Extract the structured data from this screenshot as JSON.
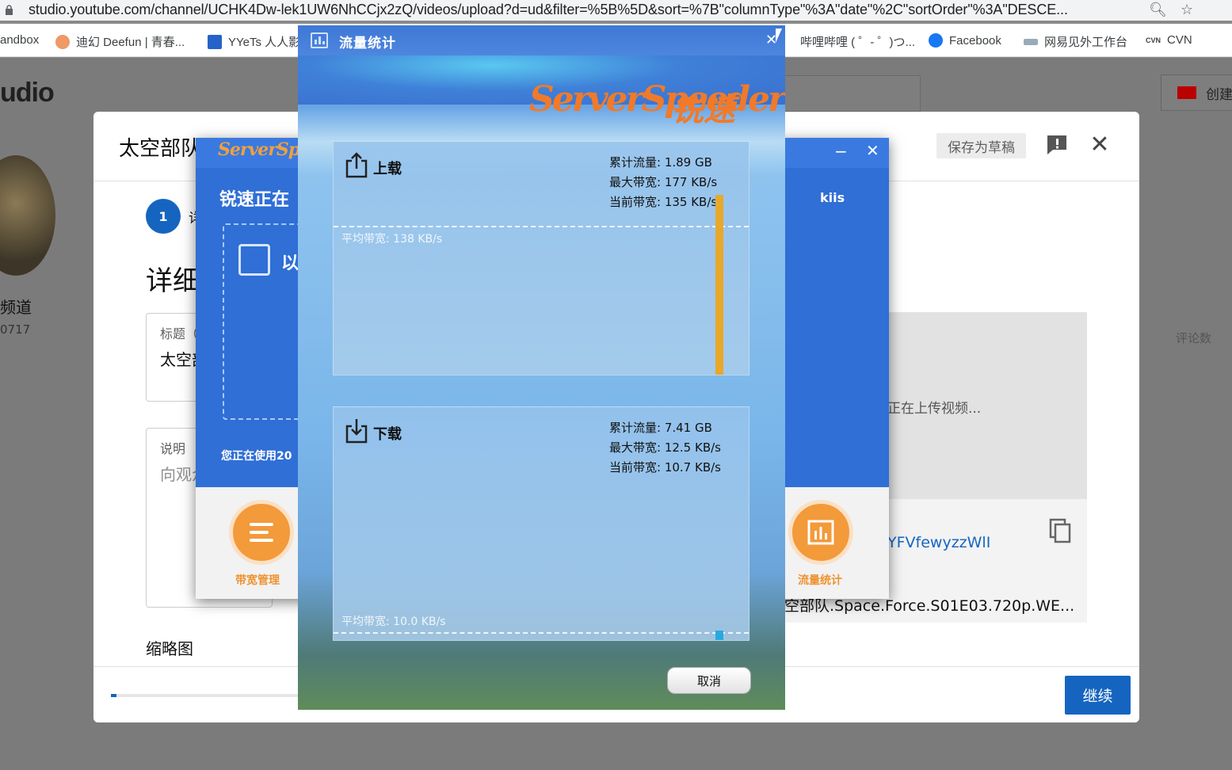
{
  "browser": {
    "url": "studio.youtube.com/channel/UCHK4Dw-lek1UW6NhCCjx2zQ/videos/upload?d=ud&filter=%5B%5D&sort=%7B\"columnType\"%3A\"date\"%2C\"sortOrder\"%3A\"DESCE...",
    "bookmarks": [
      "andbox",
      "迪幻 Deefun | 青春...",
      "YYeTs 人人影",
      "哔哩哔哩 ( ゜- ゜)つ...",
      "Facebook",
      "网易见外工作台",
      "CVN"
    ]
  },
  "studio": {
    "logo": "udio",
    "create_label": "创建",
    "channel_name": "频道",
    "channel_sub": "0717",
    "comments_col": "评论数"
  },
  "upload_dialog": {
    "title": "太空部队",
    "save_draft": "保存为草稿",
    "step_number": "1",
    "step_label": "详",
    "details_heading": "详细",
    "title_field_label": "标题（",
    "title_field_value": "太空部",
    "desc_field_label": "说明",
    "desc_field_placeholder": "向观众",
    "thumbnail_heading": "缩略图",
    "continue": "继续",
    "uploading_text": "正在上传视频...",
    "video_link": "YFVfewyzzWlI",
    "filename": "空部队.Space.Force.S01E03.720p.WE...",
    "progress": 0.03
  },
  "serverspeeder_main": {
    "logo": "ServerSpeeder",
    "status": "锐速正在",
    "mode_text": "以",
    "user": "kiis",
    "usage_text": "您正在使用20",
    "btn_bandwidth": "带宽管理",
    "btn_traffic": "流量统计"
  },
  "traffic_window": {
    "title": "流量统计",
    "brand_en": "ServerSpeeder",
    "brand_cn": "锐速",
    "upload": {
      "label": "上载",
      "total": "累计流量: 1.89 GB",
      "max": "最大带宽: 177 KB/s",
      "current": "当前带宽: 135 KB/s",
      "avg": "平均带宽: 138 KB/s",
      "bar_fraction": 0.94,
      "avg_fraction": 0.78,
      "bar_color": "#e8a82a"
    },
    "download": {
      "label": "下载",
      "total": "累计流量: 7.41 GB",
      "max": "最大带宽: 12.5 KB/s",
      "current": "当前带宽: 10.7 KB/s",
      "avg": "平均带宽: 10.0 KB/s",
      "bar_fraction": 0.05,
      "avg_fraction": 0.04,
      "bar_color": "#2aa8e0"
    },
    "cancel": "取消"
  }
}
